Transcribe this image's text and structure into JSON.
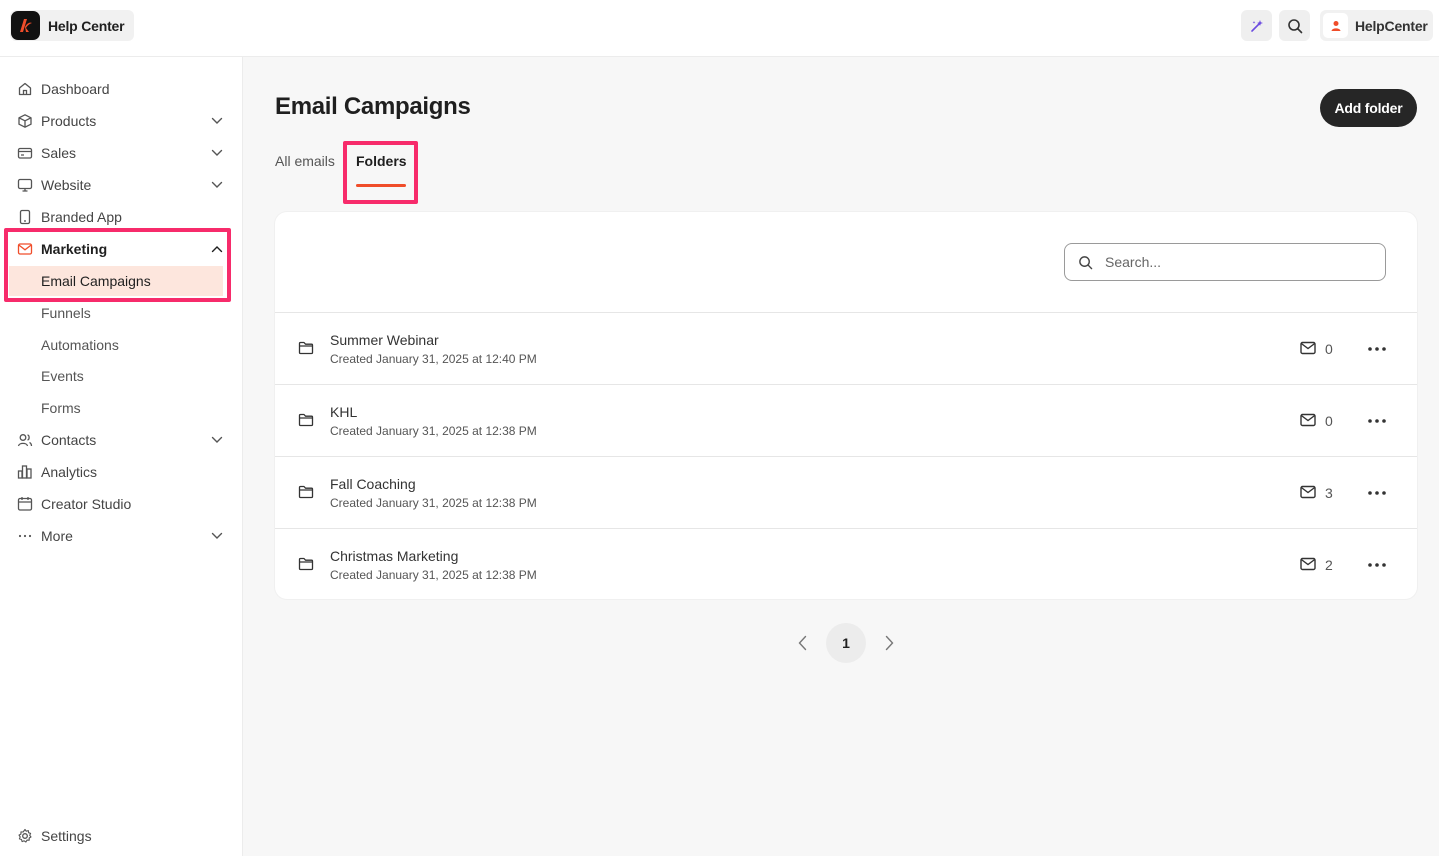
{
  "topbar": {
    "brand_name": "Help Center",
    "user_name": "HelpCenter",
    "accent_color": "#f04d2a"
  },
  "sidebar": {
    "items": [
      {
        "label": "Dashboard",
        "icon": "home-icon"
      },
      {
        "label": "Products",
        "icon": "box-icon",
        "expandable": true
      },
      {
        "label": "Sales",
        "icon": "credit-card-icon",
        "expandable": true
      },
      {
        "label": "Website",
        "icon": "monitor-icon",
        "expandable": true
      },
      {
        "label": "Branded App",
        "icon": "phone-icon"
      },
      {
        "label": "Marketing",
        "icon": "mail-icon",
        "expanded": true
      },
      {
        "label": "Contacts",
        "icon": "users-icon",
        "expandable": true
      },
      {
        "label": "Analytics",
        "icon": "bar-chart-icon"
      },
      {
        "label": "Creator Studio",
        "icon": "calendar-icon"
      },
      {
        "label": "More",
        "icon": "ellipsis-icon",
        "expandable": true
      },
      {
        "label": "Settings",
        "icon": "gear-icon"
      }
    ],
    "marketing_sub": [
      "Email Campaigns",
      "Funnels",
      "Automations",
      "Events",
      "Forms"
    ],
    "active_sub": "Email Campaigns"
  },
  "main": {
    "title": "Email Campaigns",
    "add_folder_label": "Add folder",
    "tabs": [
      {
        "label": "All emails",
        "active": false
      },
      {
        "label": "Folders",
        "active": true
      }
    ],
    "search_placeholder": "Search...",
    "folders": [
      {
        "name": "Summer Webinar",
        "created": "Created January 31, 2025 at 12:40 PM",
        "email_count": "0"
      },
      {
        "name": "KHL",
        "created": "Created January 31, 2025 at 12:38 PM",
        "email_count": "0"
      },
      {
        "name": "Fall Coaching",
        "created": "Created January 31, 2025 at 12:38 PM",
        "email_count": "3"
      },
      {
        "name": "Christmas Marketing",
        "created": "Created January 31, 2025 at 12:38 PM",
        "email_count": "2"
      }
    ],
    "pagination": {
      "current_page": "1"
    }
  },
  "highlight_color": "#f72b6b"
}
